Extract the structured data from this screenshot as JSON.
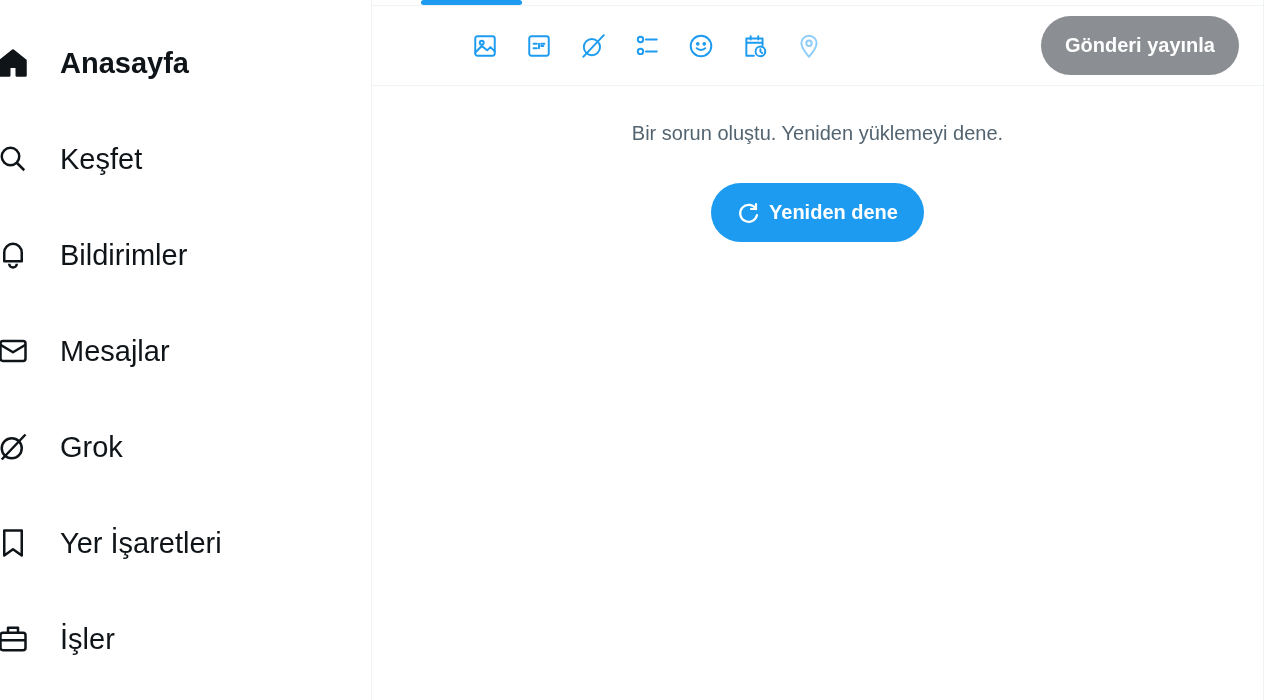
{
  "sidebar": {
    "items": [
      {
        "kind": "home",
        "label": "Anasayfa",
        "selected": true
      },
      {
        "kind": "search",
        "label": "Keşfet",
        "selected": false
      },
      {
        "kind": "bell",
        "label": "Bildirimler",
        "selected": false
      },
      {
        "kind": "mail",
        "label": "Mesajlar",
        "selected": false
      },
      {
        "kind": "grok",
        "label": "Grok",
        "selected": false
      },
      {
        "kind": "bookmark",
        "label": "Yer İşaretleri",
        "selected": false
      },
      {
        "kind": "briefcase",
        "label": "İşler",
        "selected": false
      }
    ]
  },
  "composer": {
    "tools": [
      {
        "kind": "image",
        "disabled": false
      },
      {
        "kind": "gif",
        "disabled": false
      },
      {
        "kind": "grok",
        "disabled": false
      },
      {
        "kind": "poll",
        "disabled": false
      },
      {
        "kind": "emoji",
        "disabled": false
      },
      {
        "kind": "schedule",
        "disabled": false
      },
      {
        "kind": "location",
        "disabled": true
      }
    ],
    "post_button": {
      "label": "Gönderi yayınla",
      "disabled": true
    }
  },
  "feed": {
    "error_message": "Bir sorun oluştu. Yeniden yüklemeyi dene.",
    "retry_button": {
      "label": "Yeniden dene"
    }
  }
}
